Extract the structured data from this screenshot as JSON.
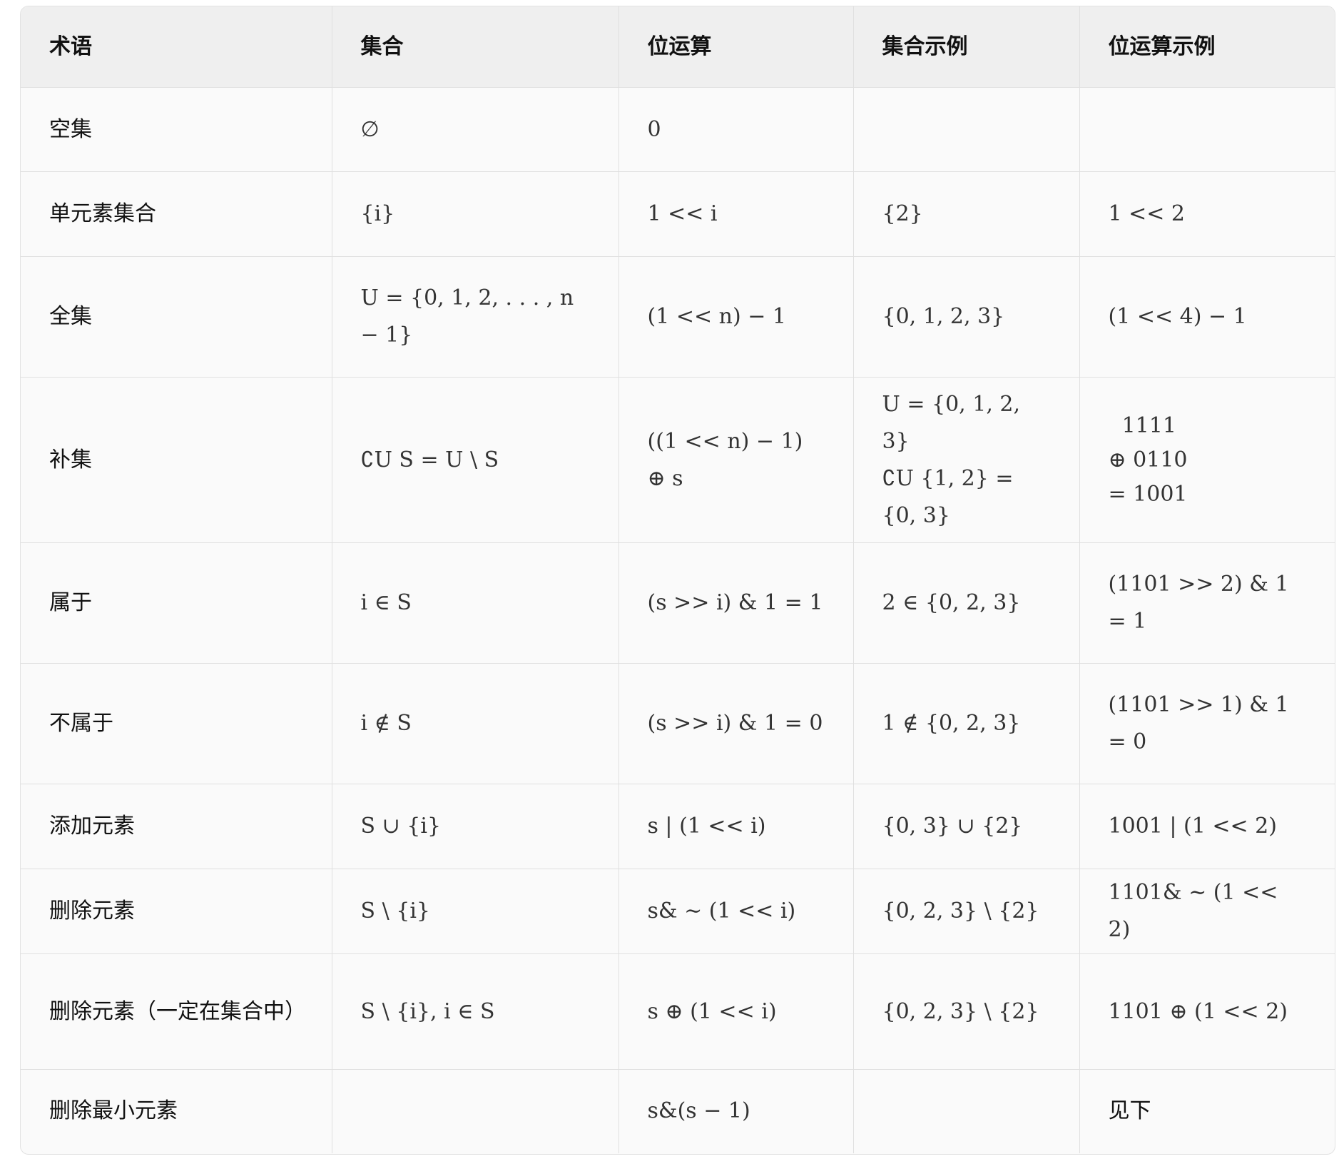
{
  "headers": [
    "术语",
    "集合",
    "位运算",
    "集合示例",
    "位运算示例"
  ],
  "rows": [
    {
      "term": "空集",
      "set": "∅",
      "bit": "0",
      "set_example": "",
      "bit_example": ""
    },
    {
      "term": "单元素集合",
      "set": "{i}",
      "bit": "1 << i",
      "set_example": "{2}",
      "bit_example": "1 << 2"
    },
    {
      "term": "全集",
      "set": "U = {0, 1, 2, . . . , n − 1}",
      "bit": "(1 << n) − 1",
      "set_example": "{0, 1, 2, 3}",
      "bit_example": "(1 << 4) − 1"
    },
    {
      "term": "补集",
      "set": "∁U S = U \\ S",
      "bit": "((1 << n) − 1) ⊕ s",
      "set_example": [
        "U = {0, 1, 2, 3}",
        "∁U {1, 2} = {0, 3}"
      ],
      "bit_example": [
        "  1111",
        "⊕ 0110",
        "= 1001"
      ]
    },
    {
      "term": "属于",
      "set": "i ∈ S",
      "bit": "(s >> i) & 1 = 1",
      "set_example": "2 ∈ {0, 2, 3}",
      "bit_example": "(1101 >> 2) & 1 = 1"
    },
    {
      "term": "不属于",
      "set": "i ∉ S",
      "bit": "(s >> i) & 1 = 0",
      "set_example": "1 ∉ {0, 2, 3}",
      "bit_example": "(1101 >> 1) & 1 = 0"
    },
    {
      "term": "添加元素",
      "set": "S ∪ {i}",
      "bit": "s | (1 << i)",
      "set_example": "{0, 3} ∪ {2}",
      "bit_example": "1001 | (1 << 2)"
    },
    {
      "term": "删除元素",
      "set": "S \\ {i}",
      "bit": "s& ∼ (1 << i)",
      "set_example": "{0, 2, 3} \\ {2}",
      "bit_example": "1101& ∼ (1 << 2)"
    },
    {
      "term": "删除元素（一定在集合中）",
      "set": "S \\ {i}, i ∈ S",
      "bit": "s ⊕ (1 << i)",
      "set_example": "{0, 2, 3} \\ {2}",
      "bit_example": "1101 ⊕ (1 << 2)"
    },
    {
      "term": "删除最小元素",
      "set": "",
      "bit": "s&(s − 1)",
      "set_example": "",
      "bit_example": "见下"
    }
  ]
}
